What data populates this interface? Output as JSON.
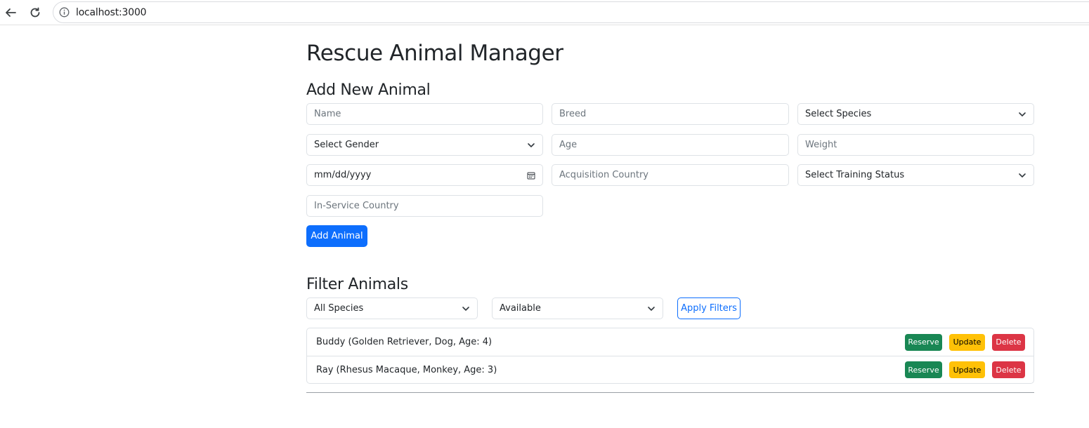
{
  "browser": {
    "url": "localhost:3000"
  },
  "page": {
    "title": "Rescue Animal Manager"
  },
  "add_form": {
    "title": "Add New Animal",
    "name_placeholder": "Name",
    "breed_placeholder": "Breed",
    "species_select": "Select Species",
    "gender_select": "Select Gender",
    "age_placeholder": "Age",
    "weight_placeholder": "Weight",
    "date_placeholder": "mm/dd/yyyy",
    "acquisition_country_placeholder": "Acquisition Country",
    "training_status_select": "Select Training Status",
    "in_service_country_placeholder": "In-Service Country",
    "submit_label": "Add Animal"
  },
  "filter": {
    "title": "Filter Animals",
    "species_value": "All Species",
    "status_value": "Available",
    "apply_label": "Apply Filters"
  },
  "animals": [
    {
      "label": "Buddy (Golden Retriever, Dog, Age: 4)"
    },
    {
      "label": "Ray (Rhesus Macaque, Monkey, Age: 3)"
    }
  ],
  "actions": {
    "reserve_label": "Reserve",
    "update_label": "Update",
    "delete_label": "Delete"
  },
  "colors": {
    "primary": "#0d6efd",
    "success": "#198754",
    "warning": "#ffc107",
    "danger": "#dc3545"
  }
}
